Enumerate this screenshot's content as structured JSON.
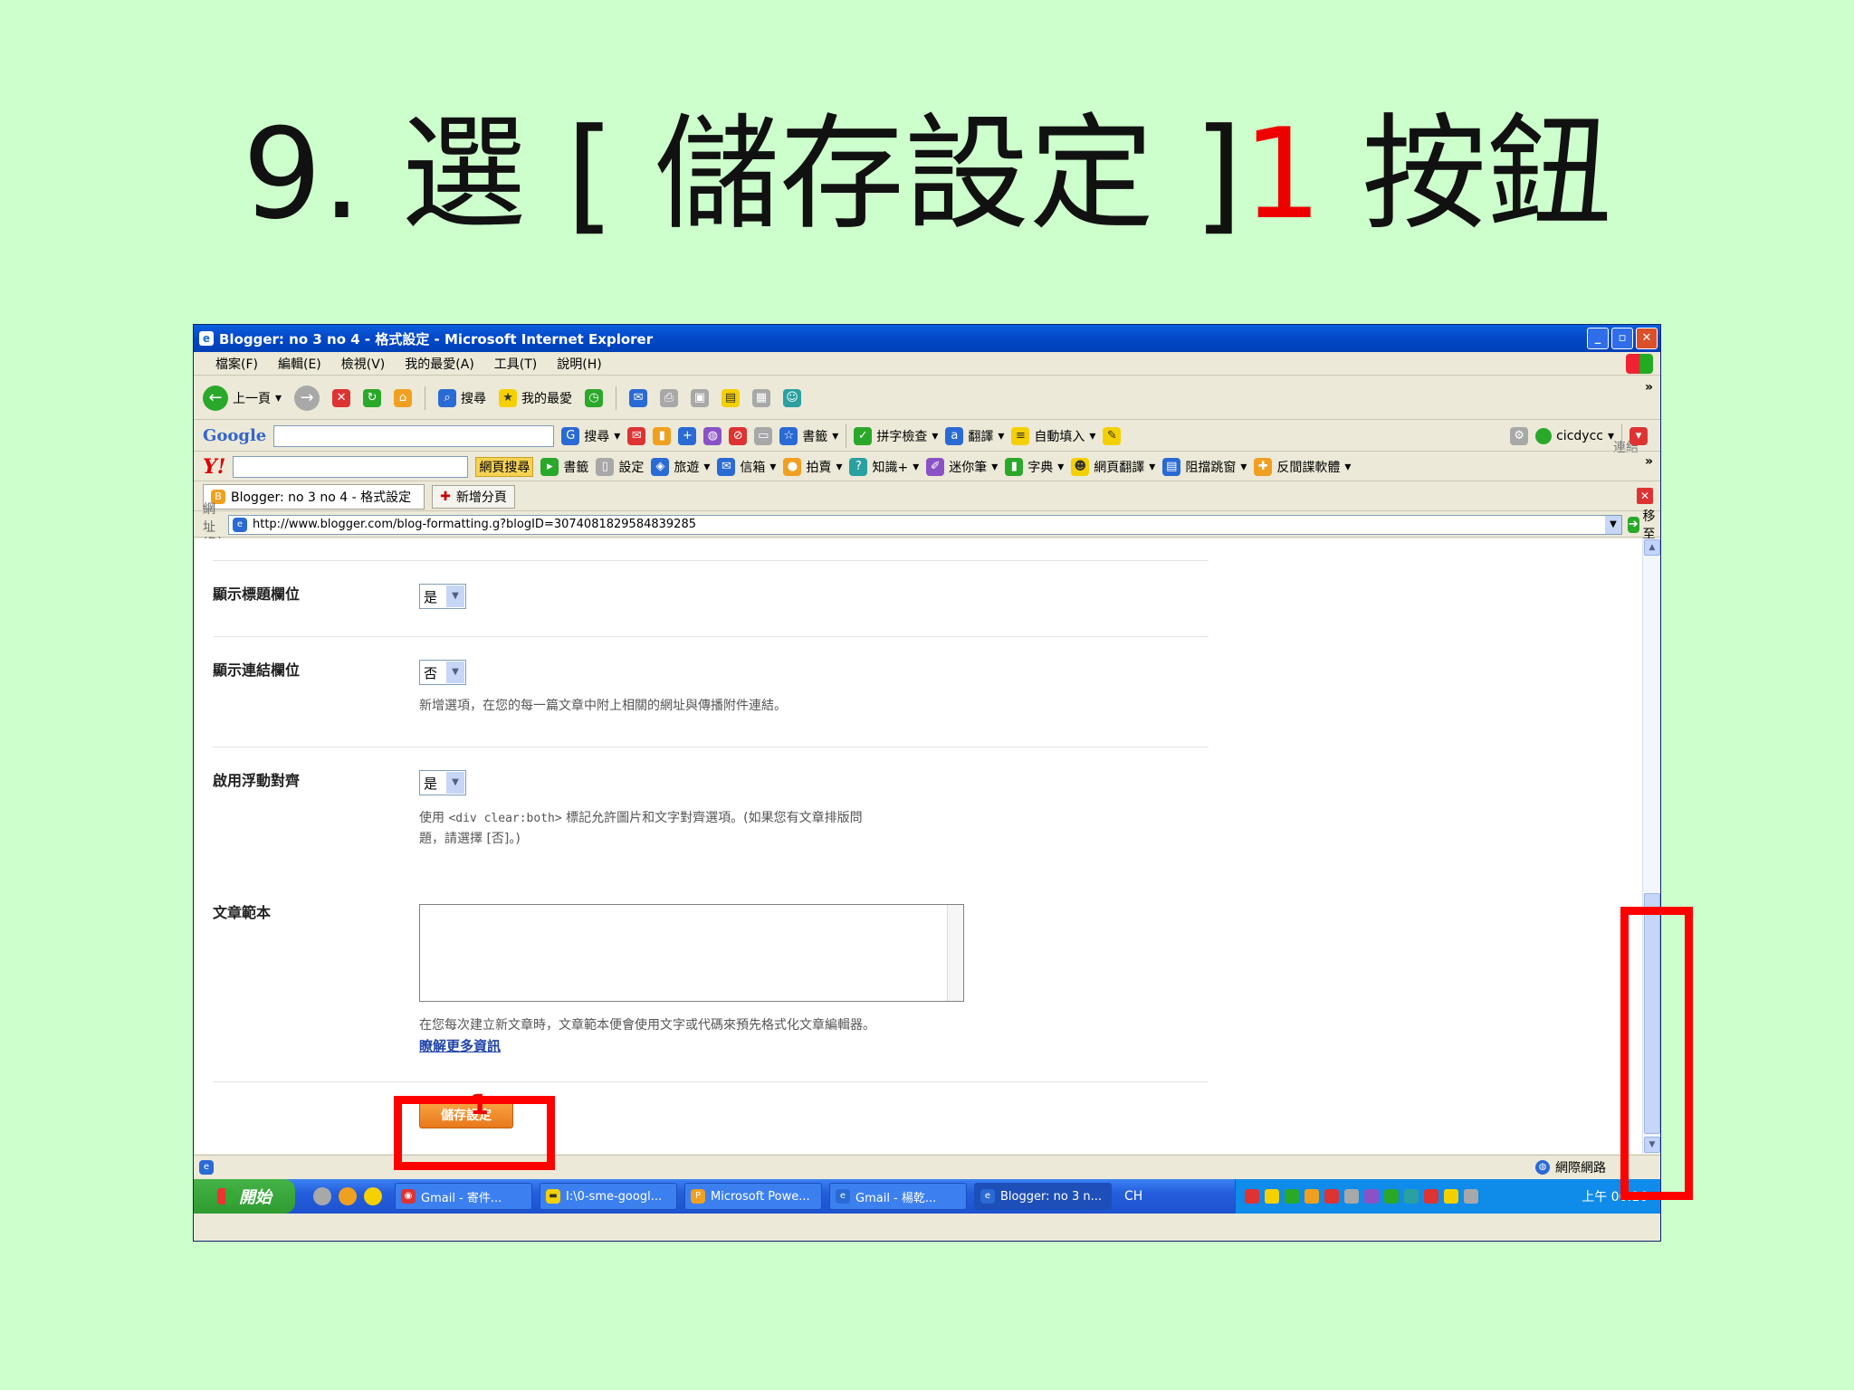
{
  "slide": {
    "title_prefix": "9. 選 [ 儲存設定 ]",
    "title_num": "1",
    "title_suffix": " 按鈕"
  },
  "window": {
    "title": "Blogger: no 3 no 4 - 格式設定 - Microsoft Internet Explorer",
    "buttons": [
      "_",
      "▫",
      "✕"
    ]
  },
  "menu": [
    "檔案(F)",
    "編輯(E)",
    "檢視(V)",
    "我的最愛(A)",
    "工具(T)",
    "說明(H)"
  ],
  "std_toolbar": {
    "back": "上一頁",
    "search": "搜尋",
    "favorites": "我的最愛",
    "links": "連結"
  },
  "google_toolbar": {
    "logo": "Google",
    "search": "搜尋",
    "bookmarks": "書籤",
    "spellcheck": "拼字檢查",
    "translate": "翻譯",
    "autofill": "自動填入",
    "account": "cicdycc"
  },
  "yahoo_toolbar": {
    "logo": "Y!",
    "web_search": "網頁搜尋",
    "items": [
      "書籤",
      "設定",
      "旅遊",
      "信箱",
      "拍賣",
      "知識+",
      "迷你筆",
      "字典",
      "網頁翻譯",
      "阻擋跳窗",
      "反間諜軟體"
    ]
  },
  "tabs": {
    "active": "Blogger: no 3 no 4 - 格式設定",
    "new_tab": "新增分頁"
  },
  "address": {
    "label": "網址(D)",
    "url": "http://www.blogger.com/blog-formatting.g?blogID=3074081829584839285",
    "go": "移至"
  },
  "form": {
    "show_title": {
      "label": "顯示標題欄位",
      "value": "是"
    },
    "show_link": {
      "label": "顯示連結欄位",
      "value": "否",
      "help": "新增選項，在您的每一篇文章中附上相關的網址與傳播附件連結。"
    },
    "float_align": {
      "label": "啟用浮動對齊",
      "value": "是",
      "help_a": "使用",
      "help_code": "<div clear:both>",
      "help_b": "標記允許圖片和文字對齊選項。(如果您有文章排版問",
      "help_c": "題，請選擇 [否]。)"
    },
    "template": {
      "label": "文章範本",
      "help": "在您每次建立新文章時，文章範本便會使用文字或代碼來預先格式化文章編輯器。",
      "learn_more": "瞭解更多資訊"
    },
    "save_label": "儲存設定",
    "save_marker": "1"
  },
  "status": {
    "zone": "網際網路"
  },
  "taskbar": {
    "start": "開始",
    "tasks": [
      "Gmail - 寄件...",
      "I:\\0-sme-googl...",
      "Microsoft Powe...",
      "Gmail - 楊乾...",
      "Blogger: no 3 n..."
    ],
    "lang": "CH",
    "clock": "上午 06:16"
  }
}
